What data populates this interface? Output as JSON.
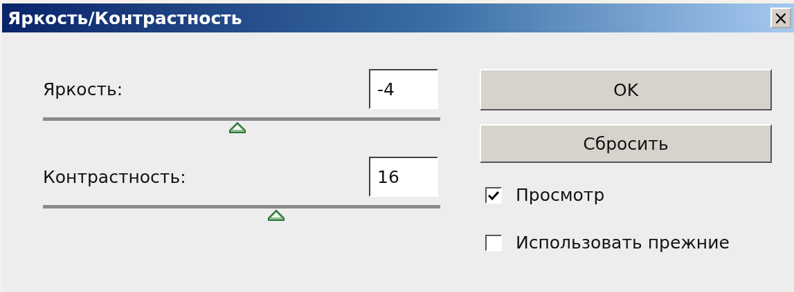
{
  "window": {
    "title": "Яркость/Контрастность",
    "close": "×"
  },
  "sliders": [
    {
      "label": "Яркость:",
      "value": "-4",
      "level": 0.49
    },
    {
      "label": "Контрастность:",
      "value": "16",
      "level": 0.587
    }
  ],
  "buttons": [
    "OK",
    "Сбросить"
  ],
  "checkboxes": [
    {
      "label": "Просмотр",
      "checked": true
    },
    {
      "label": "Использовать прежние",
      "checked": false
    }
  ]
}
